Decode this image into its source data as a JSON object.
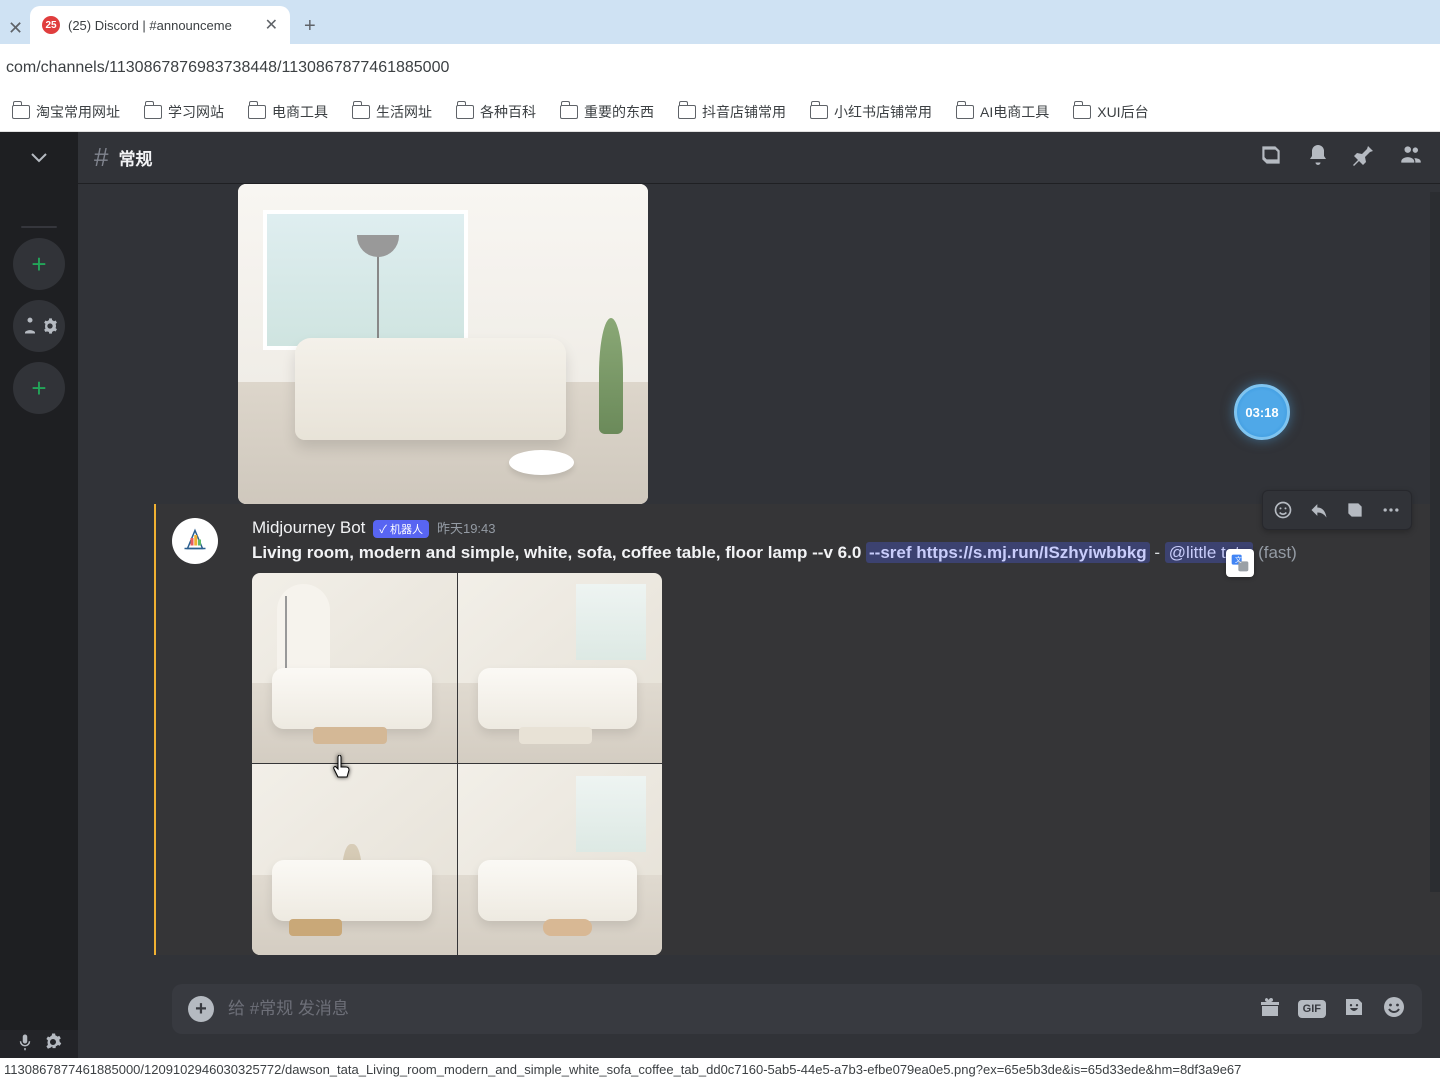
{
  "browser": {
    "tab_title": "(25) Discord | #announceme",
    "tab_badge": "25",
    "url": "com/channels/1130867876983738448/1130867877461885000"
  },
  "bookmarks": [
    "淘宝常用网址",
    "学习网站",
    "电商工具",
    "生活网址",
    "各种百科",
    "重要的东西",
    "抖音店铺常用",
    "小红书店铺常用",
    "AI电商工具",
    "XUI后台"
  ],
  "channel": {
    "name": "常规"
  },
  "timer": "03:18",
  "message": {
    "author": "Midjourney Bot",
    "bot_badge": "✓ 机器人",
    "timestamp": "昨天19:43",
    "prompt_white": "Living room, modern and simple, white, sofa, coffee table, floor lamp --v 6.0 ",
    "sref": "--sref https://s.mj.run/ISzhyiwbbkg",
    "dash": " - ",
    "mention": "@little tata",
    "fast": " (fast)"
  },
  "composer": {
    "placeholder": "给 #常规 发消息"
  },
  "status_url": "1130867877461885000/1209102946030325772/dawson_tata_Living_room_modern_and_simple_white_sofa_coffee_tab_dd0c7160-5ab5-44e5-a7b3-efbe079ea0e5.png?ex=65e5b3de&is=65d33ede&hm=8df3a9e67",
  "gif_label": "GIF"
}
